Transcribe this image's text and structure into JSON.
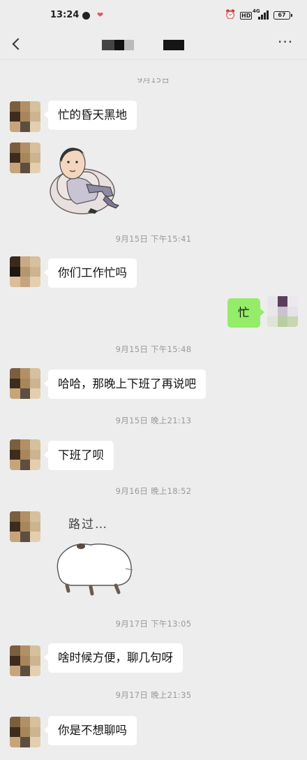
{
  "status_bar": {
    "time": "13:24",
    "network": "4G",
    "hd_label": "HD",
    "battery": "67"
  },
  "nav": {
    "back_icon": "chevron-left-icon",
    "more_icon": "more-dots-icon",
    "more_glyph": "···"
  },
  "timestamps": {
    "t0": "9月15日",
    "t1": "9月15日 下午15:41",
    "t2": "9月15日 下午15:48",
    "t3": "9月15日 晚上21:13",
    "t4": "9月16日 晚上18:52",
    "t5": "9月17日 下午13:05",
    "t6": "9月17日 晚上21:35"
  },
  "messages": {
    "m1": "忙的昏天黑地",
    "m2": "你们工作忙吗",
    "m3": "忙",
    "m4": "哈哈，那晚上下班了再说吧",
    "m5": "下班了呗",
    "m6": "啥时候方便，聊几句呀",
    "m7": "你是不想聊吗"
  },
  "stickers": {
    "s2_caption": "路过…"
  },
  "colors": {
    "background": "#ededed",
    "bubble_left": "#ffffff",
    "bubble_right": "#95ec69",
    "timestamp": "#999999"
  }
}
